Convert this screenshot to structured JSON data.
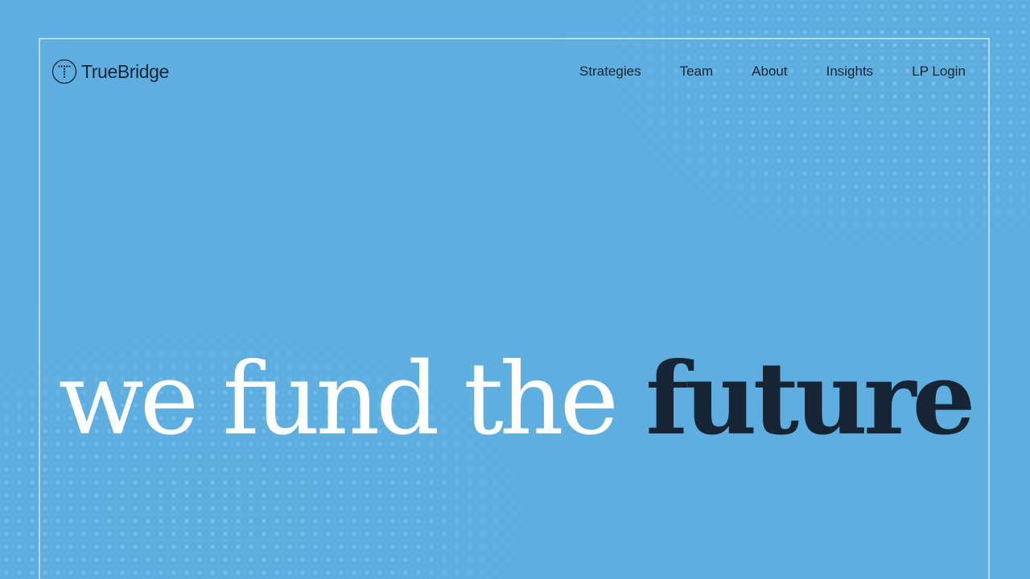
{
  "header": {
    "logo_text": "TrueBridge",
    "logo_icon": "truebridge-t-monogram-icon",
    "nav": [
      {
        "label": "Strategies"
      },
      {
        "label": "Team"
      },
      {
        "label": "About"
      },
      {
        "label": "Insights"
      },
      {
        "label": "LP Login"
      }
    ]
  },
  "hero": {
    "headline_light": "we fund the",
    "headline_bold": "future"
  },
  "colors": {
    "background": "#5eaee0",
    "text_dark": "#172433",
    "text_light": "#ffffff"
  }
}
